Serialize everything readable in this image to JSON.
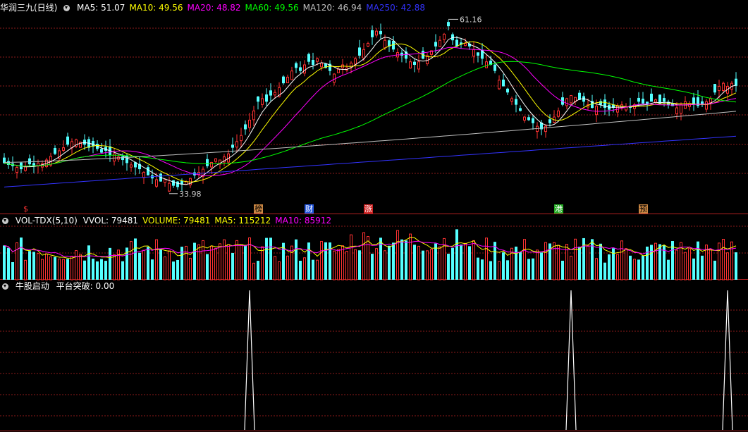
{
  "header": {
    "stock_title": "华润三九(日线)",
    "ma_labels": [
      {
        "text": "MA5: 51.07",
        "color": "#ffffff"
      },
      {
        "text": "MA10: 49.56",
        "color": "#ffff00"
      },
      {
        "text": "MA20: 48.82",
        "color": "#ff00ff"
      },
      {
        "text": "MA60: 49.56",
        "color": "#00ff00"
      },
      {
        "text": "MA120: 46.94",
        "color": "#c0c0c0"
      },
      {
        "text": "MA250: 42.88",
        "color": "#3333ff"
      }
    ]
  },
  "price_panel": {
    "high_label": "61.16",
    "low_label": "33.98",
    "price_range": [
      32,
      63
    ],
    "signals": [
      {
        "text": "$",
        "bg": "#000000",
        "color": "#ff3333",
        "index": 5
      },
      {
        "text": "榜",
        "bg": "#cc8844",
        "color": "#000000",
        "index": 60
      },
      {
        "text": "财",
        "bg": "#2255dd",
        "color": "#ffffff",
        "index": 72
      },
      {
        "text": "涨",
        "bg": "#cc2222",
        "color": "#ffffff",
        "index": 86
      },
      {
        "text": "港",
        "bg": "#22aa22",
        "color": "#ffffff",
        "index": 131
      },
      {
        "text": "预",
        "bg": "#cc8844",
        "color": "#000000",
        "index": 151
      }
    ]
  },
  "volume_panel": {
    "indicator_name": "VOL-TDX(5,10)",
    "labels": [
      {
        "text": "VVOL: 79481",
        "color": "#ffffff"
      },
      {
        "text": "VOLUME: 79481",
        "color": "#ffff00"
      },
      {
        "text": "MA5: 115212",
        "color": "#ffff00"
      },
      {
        "text": "MA10: 85912",
        "color": "#ff00ff"
      }
    ]
  },
  "indicator_panel": {
    "name": "牛股启动",
    "label": "平台突破: 0.00",
    "spike_indices": [
      58,
      134,
      171
    ]
  },
  "colors": {
    "up": "#ff3232",
    "down": "#54ffff",
    "grid": "#8b1a1a",
    "ma5": "#ffffff",
    "ma10": "#ffff00",
    "ma20": "#ff00ff",
    "ma60": "#00ff00",
    "ma120": "#c0c0c0",
    "ma250": "#3333ff"
  },
  "chart_data": {
    "type": "candlestick",
    "series_count": 176,
    "close": [
      38.5,
      38.2,
      38.0,
      37.8,
      37.5,
      37.9,
      38.3,
      38.1,
      38.5,
      38.4,
      39.0,
      39.6,
      40.0,
      40.5,
      41.0,
      41.5,
      42.0,
      42.3,
      41.9,
      41.5,
      41.0,
      41.2,
      40.8,
      40.2,
      40.5,
      39.8,
      40.0,
      39.5,
      39.0,
      38.5,
      38.2,
      37.8,
      37.5,
      37.0,
      36.5,
      36.0,
      35.8,
      35.5,
      35.8,
      35.2,
      34.8,
      34.6,
      35.0,
      35.5,
      36.0,
      36.5,
      37.0,
      37.5,
      38.0,
      38.6,
      39.2,
      39.0,
      39.5,
      40.0,
      41.0,
      42.0,
      43.0,
      44.0,
      45.5,
      47.0,
      48.5,
      49.0,
      48.5,
      49.5,
      50.0,
      50.8,
      51.5,
      52.5,
      53.5,
      54.0,
      53.5,
      54.5,
      55.0,
      54.5,
      55.5,
      54.8,
      54.0,
      53.5,
      53.0,
      53.8,
      54.5,
      54.0,
      54.8,
      55.5,
      56.0,
      57.0,
      58.0,
      59.0,
      60.0,
      59.5,
      58.5,
      57.5,
      57.0,
      56.5,
      56.0,
      55.5,
      55.0,
      54.5,
      55.0,
      55.5,
      56.0,
      56.8,
      57.5,
      58.5,
      59.5,
      60.8,
      58.5,
      57.5,
      57.8,
      58.0,
      57.5,
      57.0,
      56.0,
      55.5,
      55.0,
      54.5,
      53.5,
      52.0,
      51.0,
      50.0,
      49.0,
      48.0,
      47.0,
      46.0,
      45.5,
      45.0,
      44.5,
      44.0,
      44.5,
      45.0,
      46.0,
      47.0,
      48.0,
      49.0,
      49.5,
      49.2,
      48.8,
      48.5,
      48.0,
      47.5,
      47.8,
      48.0,
      47.5,
      47.2,
      47.5,
      47.8,
      48.0,
      47.6,
      47.5,
      48.0,
      48.5,
      48.2,
      48.0,
      48.5,
      48.8,
      48.2,
      48.5,
      48.0,
      47.8,
      47.5,
      48.0,
      48.5,
      48.2,
      48.0,
      47.8,
      48.0,
      48.5,
      49.0,
      50.0,
      51.0,
      51.5,
      51.0,
      51.5,
      51.07
    ],
    "ma_final": {
      "MA5": 51.07,
      "MA10": 49.56,
      "MA20": 48.82,
      "MA60": 49.56,
      "MA120": 46.94,
      "MA250": 42.88
    },
    "annotations": [
      {
        "text": "61.16",
        "kind": "high"
      },
      {
        "text": "33.98",
        "kind": "low"
      }
    ]
  }
}
